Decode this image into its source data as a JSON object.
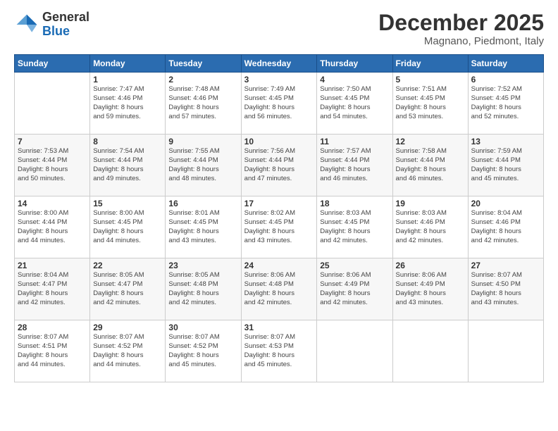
{
  "header": {
    "logo_line1": "General",
    "logo_line2": "Blue",
    "month_title": "December 2025",
    "subtitle": "Magnano, Piedmont, Italy"
  },
  "weekdays": [
    "Sunday",
    "Monday",
    "Tuesday",
    "Wednesday",
    "Thursday",
    "Friday",
    "Saturday"
  ],
  "weeks": [
    [
      {
        "day": "",
        "info": ""
      },
      {
        "day": "1",
        "info": "Sunrise: 7:47 AM\nSunset: 4:46 PM\nDaylight: 8 hours\nand 59 minutes."
      },
      {
        "day": "2",
        "info": "Sunrise: 7:48 AM\nSunset: 4:46 PM\nDaylight: 8 hours\nand 57 minutes."
      },
      {
        "day": "3",
        "info": "Sunrise: 7:49 AM\nSunset: 4:45 PM\nDaylight: 8 hours\nand 56 minutes."
      },
      {
        "day": "4",
        "info": "Sunrise: 7:50 AM\nSunset: 4:45 PM\nDaylight: 8 hours\nand 54 minutes."
      },
      {
        "day": "5",
        "info": "Sunrise: 7:51 AM\nSunset: 4:45 PM\nDaylight: 8 hours\nand 53 minutes."
      },
      {
        "day": "6",
        "info": "Sunrise: 7:52 AM\nSunset: 4:45 PM\nDaylight: 8 hours\nand 52 minutes."
      }
    ],
    [
      {
        "day": "7",
        "info": "Sunrise: 7:53 AM\nSunset: 4:44 PM\nDaylight: 8 hours\nand 50 minutes."
      },
      {
        "day": "8",
        "info": "Sunrise: 7:54 AM\nSunset: 4:44 PM\nDaylight: 8 hours\nand 49 minutes."
      },
      {
        "day": "9",
        "info": "Sunrise: 7:55 AM\nSunset: 4:44 PM\nDaylight: 8 hours\nand 48 minutes."
      },
      {
        "day": "10",
        "info": "Sunrise: 7:56 AM\nSunset: 4:44 PM\nDaylight: 8 hours\nand 47 minutes."
      },
      {
        "day": "11",
        "info": "Sunrise: 7:57 AM\nSunset: 4:44 PM\nDaylight: 8 hours\nand 46 minutes."
      },
      {
        "day": "12",
        "info": "Sunrise: 7:58 AM\nSunset: 4:44 PM\nDaylight: 8 hours\nand 46 minutes."
      },
      {
        "day": "13",
        "info": "Sunrise: 7:59 AM\nSunset: 4:44 PM\nDaylight: 8 hours\nand 45 minutes."
      }
    ],
    [
      {
        "day": "14",
        "info": "Sunrise: 8:00 AM\nSunset: 4:44 PM\nDaylight: 8 hours\nand 44 minutes."
      },
      {
        "day": "15",
        "info": "Sunrise: 8:00 AM\nSunset: 4:45 PM\nDaylight: 8 hours\nand 44 minutes."
      },
      {
        "day": "16",
        "info": "Sunrise: 8:01 AM\nSunset: 4:45 PM\nDaylight: 8 hours\nand 43 minutes."
      },
      {
        "day": "17",
        "info": "Sunrise: 8:02 AM\nSunset: 4:45 PM\nDaylight: 8 hours\nand 43 minutes."
      },
      {
        "day": "18",
        "info": "Sunrise: 8:03 AM\nSunset: 4:45 PM\nDaylight: 8 hours\nand 42 minutes."
      },
      {
        "day": "19",
        "info": "Sunrise: 8:03 AM\nSunset: 4:46 PM\nDaylight: 8 hours\nand 42 minutes."
      },
      {
        "day": "20",
        "info": "Sunrise: 8:04 AM\nSunset: 4:46 PM\nDaylight: 8 hours\nand 42 minutes."
      }
    ],
    [
      {
        "day": "21",
        "info": "Sunrise: 8:04 AM\nSunset: 4:47 PM\nDaylight: 8 hours\nand 42 minutes."
      },
      {
        "day": "22",
        "info": "Sunrise: 8:05 AM\nSunset: 4:47 PM\nDaylight: 8 hours\nand 42 minutes."
      },
      {
        "day": "23",
        "info": "Sunrise: 8:05 AM\nSunset: 4:48 PM\nDaylight: 8 hours\nand 42 minutes."
      },
      {
        "day": "24",
        "info": "Sunrise: 8:06 AM\nSunset: 4:48 PM\nDaylight: 8 hours\nand 42 minutes."
      },
      {
        "day": "25",
        "info": "Sunrise: 8:06 AM\nSunset: 4:49 PM\nDaylight: 8 hours\nand 42 minutes."
      },
      {
        "day": "26",
        "info": "Sunrise: 8:06 AM\nSunset: 4:49 PM\nDaylight: 8 hours\nand 43 minutes."
      },
      {
        "day": "27",
        "info": "Sunrise: 8:07 AM\nSunset: 4:50 PM\nDaylight: 8 hours\nand 43 minutes."
      }
    ],
    [
      {
        "day": "28",
        "info": "Sunrise: 8:07 AM\nSunset: 4:51 PM\nDaylight: 8 hours\nand 44 minutes."
      },
      {
        "day": "29",
        "info": "Sunrise: 8:07 AM\nSunset: 4:52 PM\nDaylight: 8 hours\nand 44 minutes."
      },
      {
        "day": "30",
        "info": "Sunrise: 8:07 AM\nSunset: 4:52 PM\nDaylight: 8 hours\nand 45 minutes."
      },
      {
        "day": "31",
        "info": "Sunrise: 8:07 AM\nSunset: 4:53 PM\nDaylight: 8 hours\nand 45 minutes."
      },
      {
        "day": "",
        "info": ""
      },
      {
        "day": "",
        "info": ""
      },
      {
        "day": "",
        "info": ""
      }
    ]
  ]
}
